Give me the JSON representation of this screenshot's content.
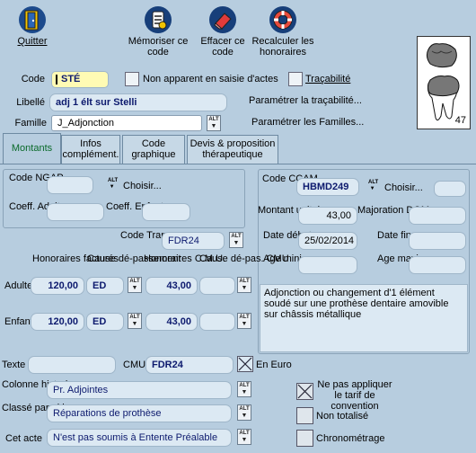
{
  "toolbar": {
    "quit": "Quitter",
    "save": "Mémoriser ce code",
    "delete": "Effacer ce code",
    "recalc": "Recalculer les honoraires"
  },
  "header": {
    "code_label": "Code",
    "code_value": "STÉ",
    "hidden_label": "Non apparent en saisie d'actes",
    "trace_label": "Traçabilité",
    "libelle_label": "Libellé",
    "libelle_value": "adj 1 élt sur Stelli",
    "param_trace": "Paramétrer la traçabilité...",
    "famille_label": "Famille",
    "famille_value": "J_Adjonction",
    "param_familles": "Paramétrer les Familles...",
    "tooth_number": "47"
  },
  "tabs": [
    {
      "label": "Montants"
    },
    {
      "label": "Infos complément."
    },
    {
      "label": "Code graphique"
    },
    {
      "label": "Devis & proposition thérapeutique"
    }
  ],
  "ngap": {
    "code_label": "Code NGAP",
    "choose": "Choisir...",
    "coeff_adulte": "Coeff. Adulte",
    "coeff_enfant": "Coeff. Enfant"
  },
  "ccam": {
    "code_label": "Code CCAM",
    "code_value": "HBMD249",
    "choose": "Choisir...",
    "montant_label": "Montant unitaire",
    "montant_value": "43,00",
    "majoration_label": "Majoration DOM",
    "date_debut_label": "Date début",
    "date_debut_value": "25/02/2014",
    "date_fin_label": "Date fin",
    "age_mini_label": "Age mini",
    "age_maxi_label": "Age maxi",
    "description": "Adjonction ou changement d'1 élément soudé sur une prothèse dentaire amovible sur châssis métallique"
  },
  "transpo": {
    "label": "Code Transpo",
    "value": "FDR24"
  },
  "fees": {
    "col_honoraires": "Honoraires facturés",
    "col_cause": "Cause dé-passement",
    "col_cmu": "Honoraires C.M.U.",
    "col_cause_cmu": "Cause dé-pas. CMU",
    "adulte_label": "Adulte",
    "enfant_label": "Enfant",
    "adulte": {
      "honoraires": "120,00",
      "cause": "ED",
      "cmu": "43,00"
    },
    "enfant": {
      "honoraires": "120,00",
      "cause": "ED",
      "cmu": "43,00"
    }
  },
  "bottom": {
    "texte_label": "Texte",
    "cmu_label": "CMU",
    "cmu_value": "FDR24",
    "euro_label": "En Euro",
    "colonne_label": "Colonne historique",
    "colonne_value": "Pr. Adjointes",
    "classe_label": "Classé parmi les",
    "classe_value": "Réparations de prothèse",
    "cet_acte_label": "Cet acte",
    "cet_acte_value": "N'est pas soumis à Entente Préalable",
    "no_tarif_label": "Ne pas appliquer le tarif de convention",
    "non_totalise_label": "Non totalisé",
    "chrono_label": "Chronométrage"
  },
  "colors": {
    "background": "#b7cddf",
    "field": "#dce9f3",
    "bold_value": "#0d1a6e",
    "active_tab": "#0a6a2a"
  }
}
